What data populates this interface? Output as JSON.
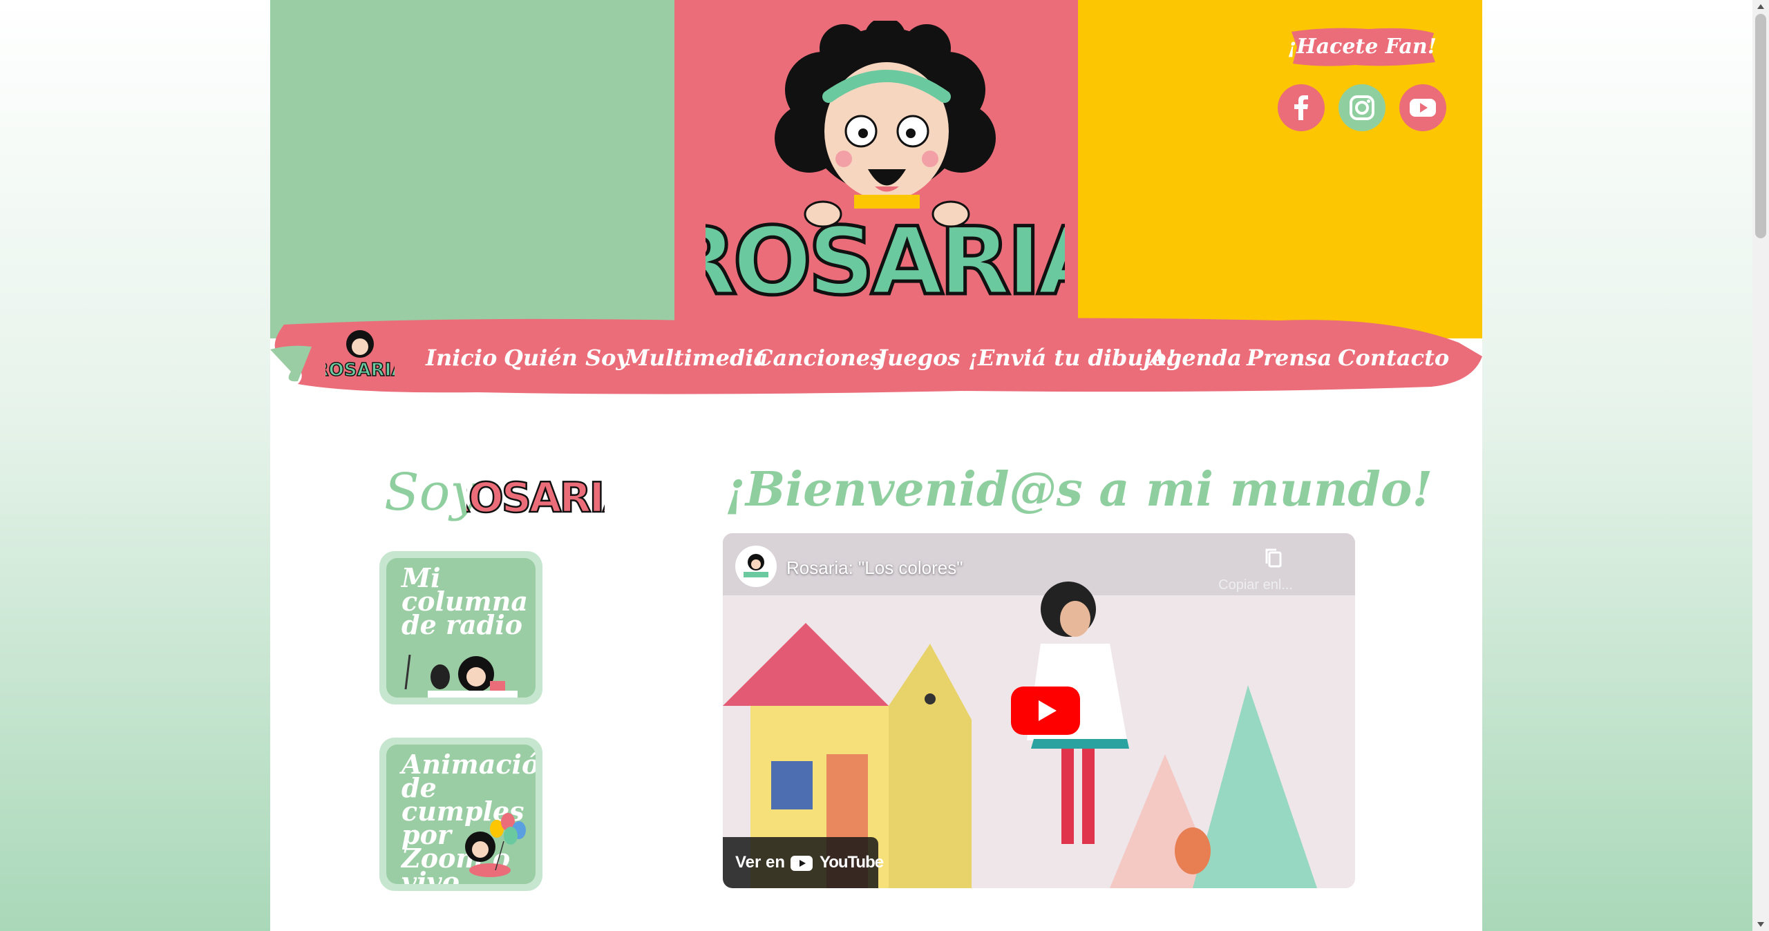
{
  "brand": {
    "logo_text": "ROSARIA"
  },
  "header": {
    "fan_label": "¡Hacete Fan!",
    "social": [
      {
        "name": "facebook",
        "icon": "facebook-icon",
        "color": "#eb6d79"
      },
      {
        "name": "instagram",
        "icon": "instagram-icon",
        "color": "#8fcf9f"
      },
      {
        "name": "youtube",
        "icon": "youtube-icon",
        "color": "#eb6d79"
      }
    ]
  },
  "nav": {
    "items": [
      {
        "label": "Inicio"
      },
      {
        "label": "Quién Soy"
      },
      {
        "label": "Multimedia"
      },
      {
        "label": "Canciones"
      },
      {
        "label": "Juegos"
      },
      {
        "label": "¡Enviá tu dibujo!"
      },
      {
        "label": "Agenda"
      },
      {
        "label": "Prensa"
      },
      {
        "label": "Contacto"
      }
    ]
  },
  "sidebar": {
    "title": "Soy",
    "cards": [
      {
        "label": "Mi columna de radio"
      },
      {
        "label": "Animación de cumples por Zoom o vivo"
      }
    ]
  },
  "main": {
    "welcome": "¡Bienvenid@s a mi mundo!",
    "video": {
      "title": "Rosaria: \"Los colores\"",
      "copy_label": "Copiar enl...",
      "watch_on": "Ver en",
      "platform": "YouTube"
    }
  },
  "colors": {
    "green": "#9bcda4",
    "pink": "#eb6d79",
    "yellow": "#fcc603",
    "title_green": "#8fcf9f",
    "youtube_red": "#ff0000"
  }
}
